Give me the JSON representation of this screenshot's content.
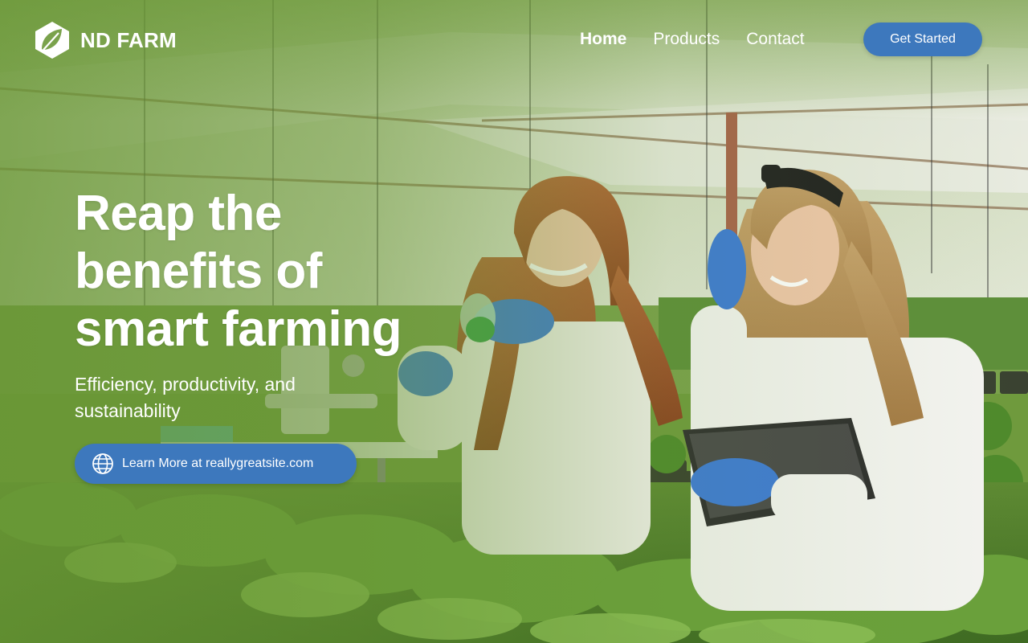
{
  "brand": {
    "name": "ND FARM",
    "logo_icon": "leaf-shield-icon"
  },
  "nav": {
    "items": [
      {
        "label": "Home",
        "active": true
      },
      {
        "label": "Products",
        "active": false
      },
      {
        "label": "Contact",
        "active": false
      }
    ],
    "cta_label": "Get Started"
  },
  "hero": {
    "title_lines": [
      "Reap the",
      "benefits of",
      "smart farming"
    ],
    "subtitle_lines": [
      "Efficiency, productivity, and",
      "sustainability"
    ],
    "learn_more_label": "Learn More at reallygreatsite.com",
    "learn_more_icon": "globe-icon"
  },
  "theme": {
    "accent": "#3d78bd",
    "overlay_green": "#6f9a3d",
    "text": "#ffffff"
  }
}
